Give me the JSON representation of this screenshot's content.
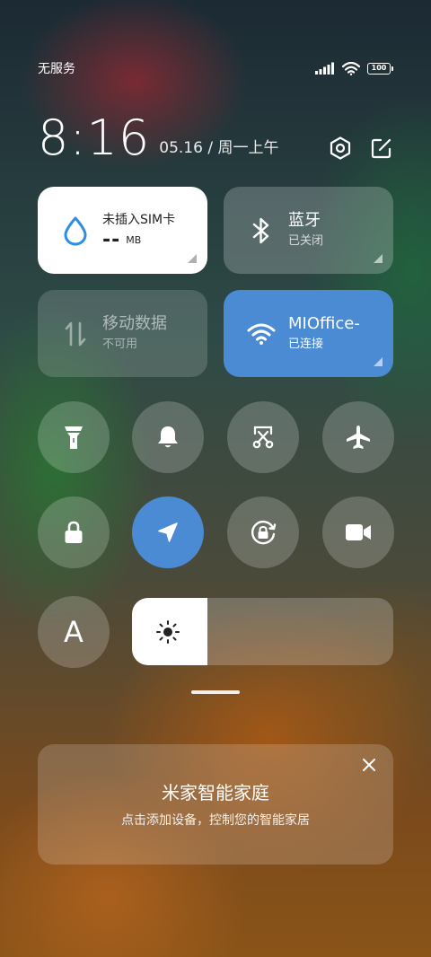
{
  "status_bar": {
    "carrier": "无服务",
    "battery": "100"
  },
  "header": {
    "time": "8:16",
    "date": "05.16 / 周一上午"
  },
  "tiles": {
    "sim": {
      "title": "未插入SIM卡",
      "value": "--",
      "unit": "MB"
    },
    "bluetooth": {
      "title": "蓝牙",
      "status": "已关闭"
    },
    "mobile_data": {
      "title": "移动数据",
      "status": "不可用"
    },
    "wifi": {
      "title": "MIOffice-",
      "status": "已连接"
    }
  },
  "toggles": {
    "flashlight": "flashlight-icon",
    "silent": "bell-icon",
    "screenshot": "scissors-icon",
    "airplane": "airplane-icon",
    "lock": "lock-icon",
    "location": "location-icon",
    "rotation_lock": "rotation-lock-icon",
    "screen_record": "video-camera-icon"
  },
  "brightness": {
    "auto_label": "A",
    "level_percent": 29
  },
  "smart_home_card": {
    "title": "米家智能家庭",
    "subtitle": "点击添加设备，控制您的智能家居"
  },
  "colors": {
    "accent": "#4a8bd4",
    "tile_white": "#ffffff"
  }
}
